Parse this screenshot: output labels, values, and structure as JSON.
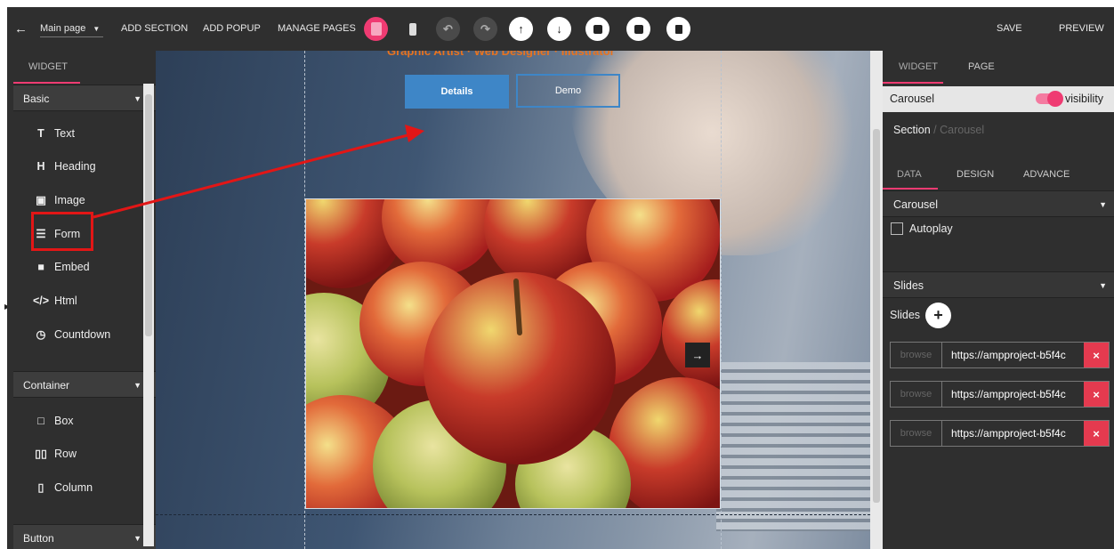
{
  "topbar": {
    "back_icon": "arrow-left-icon",
    "page_select": "Main page",
    "add_section": "ADD SECTION",
    "add_popup": "ADD POPUP",
    "manage_pages": "MANAGE PAGES",
    "save": "SAVE",
    "preview": "PREVIEW",
    "tools": [
      "tablet-icon",
      "phone-icon",
      "undo-icon",
      "redo-icon",
      "move-up-icon",
      "move-down-icon",
      "duplicate-icon",
      "copy-icon",
      "delete-icon"
    ]
  },
  "left": {
    "tab": "WIDGET",
    "basic": {
      "label": "Basic",
      "items": [
        {
          "icon": "T",
          "label": "Text"
        },
        {
          "icon": "H",
          "label": "Heading"
        },
        {
          "icon": "▣",
          "label": "Image"
        },
        {
          "icon": "☰",
          "label": "Form"
        },
        {
          "icon": "■",
          "label": "Embed"
        },
        {
          "icon": "</>",
          "label": "Html"
        },
        {
          "icon": "◷",
          "label": "Countdown"
        }
      ]
    },
    "container": {
      "label": "Container",
      "items": [
        {
          "icon": "□",
          "label": "Box"
        },
        {
          "icon": "▯▯",
          "label": "Row"
        },
        {
          "icon": "▯",
          "label": "Column"
        }
      ]
    },
    "button": {
      "label": "Button"
    }
  },
  "canvas": {
    "headline": "Graphic Artist · Web Designer · Illustrator",
    "details_button": "Details",
    "demo_button": "Demo",
    "next_icon": "→"
  },
  "right": {
    "tabs": [
      "WIDGET",
      "PAGE"
    ],
    "selected": "Carousel",
    "visibility": "visibility",
    "breadcrumb": {
      "section": "Section",
      "sep": " / ",
      "current": "Carousel"
    },
    "subtabs": [
      "DATA",
      "DESIGN",
      "ADVANCE"
    ],
    "carousel_section": "Carousel",
    "autoplay": "Autoplay",
    "slides_section": "Slides",
    "slides_label": "Slides",
    "add_slide": "+",
    "slides": [
      {
        "browse": "browse",
        "url": "https://ampproject-b5f4c"
      },
      {
        "browse": "browse",
        "url": "https://ampproject-b5f4c"
      },
      {
        "browse": "browse",
        "url": "https://ampproject-b5f4c"
      }
    ],
    "remove": "×"
  },
  "colors": {
    "accent": "#ef3b72",
    "toolbar": "#2f2f2f",
    "annotation": "#e21616",
    "button": "#3e86c7"
  }
}
